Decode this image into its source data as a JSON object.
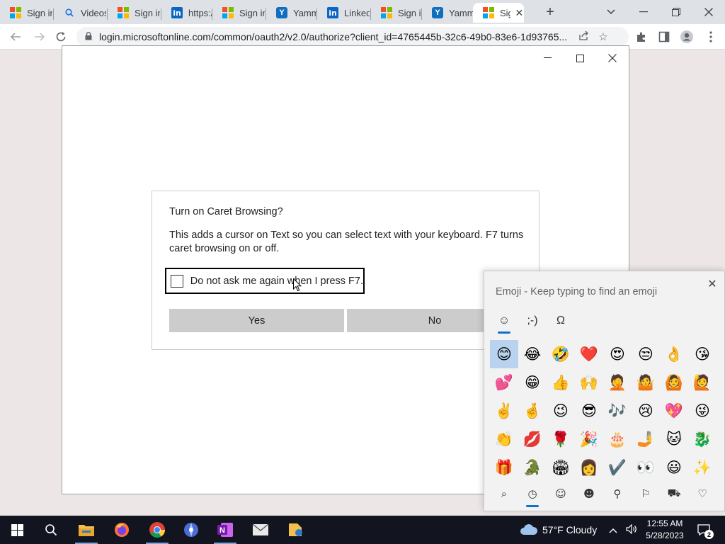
{
  "browser": {
    "tabs": [
      {
        "title": "Sign in",
        "icon": "microsoft-logo"
      },
      {
        "title": "Videos",
        "icon": "search-icon"
      },
      {
        "title": "Sign in",
        "icon": "microsoft-logo"
      },
      {
        "title": "https://",
        "icon": "linkedin-logo"
      },
      {
        "title": "Sign in",
        "icon": "microsoft-logo"
      },
      {
        "title": "Yammer",
        "icon": "yammer-logo"
      },
      {
        "title": "LinkedIn",
        "icon": "linkedin-logo"
      },
      {
        "title": "Sign in",
        "icon": "microsoft-logo"
      },
      {
        "title": "Yammer",
        "icon": "yammer-logo"
      },
      {
        "title": "Sign in",
        "icon": "microsoft-logo",
        "active": true
      }
    ],
    "new_tab_symbol": "+",
    "url": "login.microsoftonline.com/common/oauth2/v2.0/authorize?client_id=4765445b-32c6-49b0-83e6-1d93765..."
  },
  "dialog": {
    "title": "Turn on Caret Browsing?",
    "body": "This adds a cursor on Text so you can select text with your keyboard. F7 turns caret browsing on or off.",
    "checkbox_label": "Do not ask me again when I press F7.",
    "checkbox_checked": false,
    "yes_label": "Yes",
    "no_label": "No"
  },
  "emoji_panel": {
    "search_placeholder": "Emoji - Keep typing to find an emoji",
    "tabs": [
      "☺",
      ";-)",
      "Ω"
    ],
    "selected_tab": 0,
    "emojis": [
      "😊",
      "😂",
      "🤣",
      "❤️",
      "😍",
      "😒",
      "👌",
      "😘",
      "💕",
      "😁",
      "👍",
      "🙌",
      "🤦",
      "🤷",
      "🙆",
      "🙋",
      "✌️",
      "🤞",
      "😉",
      "😎",
      "🎶",
      "😢",
      "💖",
      "😜",
      "👏",
      "💋",
      "🌹",
      "🎉",
      "🎂",
      "🤳",
      "🐱",
      "🐉",
      "🎁",
      "🐊",
      "🏟",
      "👩",
      "✔️",
      "👀",
      "😃",
      "✨"
    ],
    "selected_emoji": 0,
    "categories": [
      "search",
      "recent",
      "smileys",
      "people",
      "celebration",
      "food",
      "travel",
      "hearts"
    ],
    "category_glyphs": [
      "⌕",
      "◷",
      "☺",
      "☻",
      "⚲",
      "⚐",
      "⛟",
      "♡"
    ],
    "selected_category": 1
  },
  "taskbar": {
    "weather": "57°F  Cloudy",
    "time": "12:55 AM",
    "date": "5/28/2023",
    "notification_count": "2"
  }
}
